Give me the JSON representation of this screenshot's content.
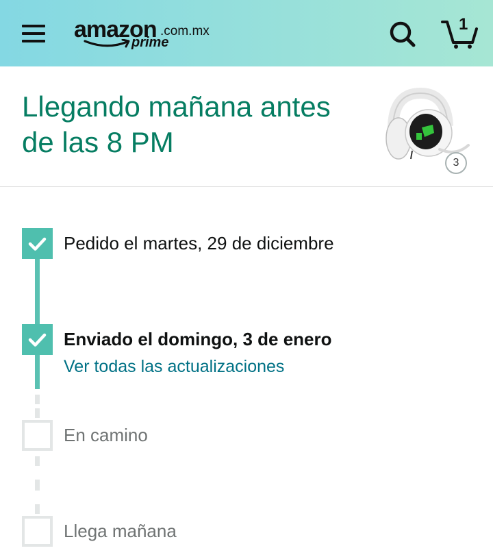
{
  "header": {
    "logo": {
      "wordmark": "amazon",
      "domain": ".com.mx",
      "program": "prime"
    },
    "icons": {
      "menu": "menu-icon",
      "search": "search-icon",
      "cart": "cart-icon"
    },
    "cart_count": "1",
    "colors": {
      "gradient_start": "#84d8e3",
      "gradient_end": "#a6e6d4"
    }
  },
  "delivery": {
    "headline": "Llegando mañana antes de las 8 PM",
    "item_quantity": "3",
    "accent_color": "#067d62"
  },
  "timeline": {
    "steps": [
      {
        "label": "Pedido el martes, 29 de diciembre",
        "done": true
      },
      {
        "label": "Enviado el domingo, 3 de enero",
        "done": true,
        "link": "Ver todas las actualizaciones"
      },
      {
        "label": "En camino",
        "done": false
      },
      {
        "label": "Llega mañana",
        "done": false
      }
    ],
    "done_color": "#4fbfae",
    "link_color": "#007185"
  }
}
